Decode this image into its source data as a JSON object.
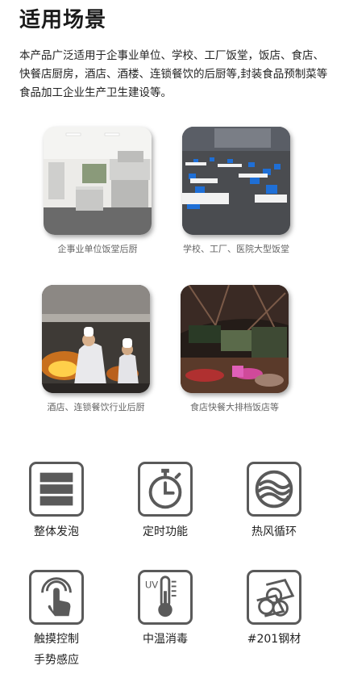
{
  "section": {
    "title": "适用场景",
    "intro": "本产品广泛适用于企事业单位、学校、工厂饭堂，饭店、食店、快餐店厨房，酒店、酒楼、连锁餐饮的后厨等,封装食品预制菜等食品加工企业生产卫生建设等。"
  },
  "scenes": [
    {
      "caption": "企事业单位饭堂后厨"
    },
    {
      "caption": "学校、工厂、医院大型饭堂"
    },
    {
      "caption": "酒店、连锁餐饮行业后厨"
    },
    {
      "caption": "食店快餐大排档饭店等"
    }
  ],
  "features": [
    {
      "label": "整体发泡",
      "icon": "layers-icon"
    },
    {
      "label": "定时功能",
      "icon": "timer-icon"
    },
    {
      "label": "热风循环",
      "icon": "hot-air-icon"
    },
    {
      "label": "触摸控制",
      "label2": "手势感应",
      "icon": "touch-icon"
    },
    {
      "label": "中温消毒",
      "icon": "thermometer-icon",
      "icon_text": "UV"
    },
    {
      "label": "#201钢材",
      "icon": "steel-tubes-icon"
    }
  ],
  "colors": {
    "icon_stroke": "#5a5a5a",
    "caption": "#666666"
  }
}
